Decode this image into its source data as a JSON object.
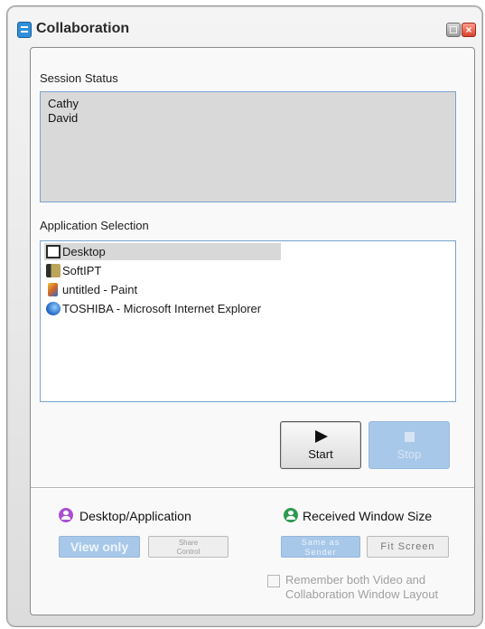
{
  "window": {
    "title": "Collaboration"
  },
  "session": {
    "label": "Session Status",
    "users": [
      "Cathy",
      "David"
    ]
  },
  "apps": {
    "label": "Application Selection",
    "items": [
      {
        "name": "Desktop",
        "icon": "desktop-icon",
        "selected": true
      },
      {
        "name": "SoftIPT",
        "icon": "softipt-app-icon"
      },
      {
        "name": "untitled - Paint",
        "icon": "paint-app-icon"
      },
      {
        "name": "TOSHIBA - Microsoft Internet Explorer",
        "icon": "internet-explorer-icon"
      }
    ]
  },
  "controls": {
    "start_label": "Start",
    "stop_label": "Stop"
  },
  "desktop_application": {
    "title": "Desktop/Application",
    "view_only_label": "View only",
    "share_control_label_1": "Share",
    "share_control_label_2": "Control"
  },
  "window_size": {
    "title": "Received Window Size",
    "same_as_sender_label_1": "Same as",
    "same_as_sender_label_2": "Sender",
    "fit_screen_label": "Fit Screen"
  },
  "remember": {
    "label": "Remember both Video and Collaboration Window Layout",
    "checked": false
  },
  "colors": {
    "accent_disabled_blue": "#a8c8ea",
    "close_red": "#d5432d",
    "purple_icon": "#a94fd2",
    "green_icon": "#2e9a52"
  }
}
